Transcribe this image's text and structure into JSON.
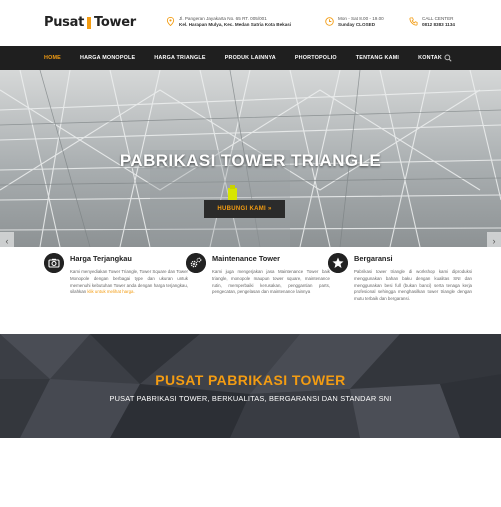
{
  "header": {
    "logo_left": "Pusat",
    "logo_right": "Tower",
    "address_line1": "Jl. Pangeran Jayakarta No. 65 RT. 005/001",
    "address_line2": "Kel. Harapan Mulya, Kec. Medan Satria Kota Bekasi",
    "hours_line1": "Mon - Sat 8.00 - 19.00",
    "hours_line2": "Sunday CLOSED",
    "call_label": "CALL CENTER",
    "call_number": "0812 8383 1134",
    "accent_color": "#f39c12",
    "icons": [
      "location-icon",
      "clock-icon",
      "phone-icon"
    ]
  },
  "nav": {
    "items": [
      {
        "label": "HOME",
        "active": true
      },
      {
        "label": "HARGA MONOPOLE"
      },
      {
        "label": "HARGA TRIANGLE"
      },
      {
        "label": "PRODUK LAINNYA"
      },
      {
        "label": "PHORTOPOLIO"
      },
      {
        "label": "TENTANG KAMI"
      },
      {
        "label": "KONTAK"
      }
    ],
    "search_icon": "search-icon"
  },
  "hero": {
    "title": "PABRIKASI TOWER TRIANGLE",
    "button_label": "HUBUNGI KAMI »",
    "prev_arrow": "‹",
    "next_arrow": "›"
  },
  "features": [
    {
      "icon": "camera-icon",
      "title": "Harga Terjangkau",
      "text": "Kami menyediakan Tower Triangle, Tower Square dan Tower Monopole dengan berbagai type dan ukuran untuk memenuhi kebutuhan Tower anda dengan harga terjangkau, silahkan ",
      "link": "klik untuk melihat harga."
    },
    {
      "icon": "gears-icon",
      "title": "Maintenance Tower",
      "text": "Kami juga mengerjakan jasa Maintenance Tower baik triangle, monopole maupun tower square, maintenance rutin, memperbaiki kerusakan, penggantian parts, pengecatan, pengelasan dan maintenance lainnya"
    },
    {
      "icon": "star-icon",
      "title": "Bergaransi",
      "text": "Pabrikasi tower triangle di workshop kami diproduksi menggunakan bahan baku dengan kualitas SNI dan menggunakan besi full (bukan banci) serta tenaga kerja profesional sehingga menghasilkan tower triangle dengan mutu terbaik dan bergaransi."
    }
  ],
  "banner": {
    "title": "PUSAT PABRIKASI TOWER",
    "subtitle": "PUSAT PABRIKASI TOWER, BERKUALITAS, BERGARANSI DAN STANDAR SNI"
  }
}
